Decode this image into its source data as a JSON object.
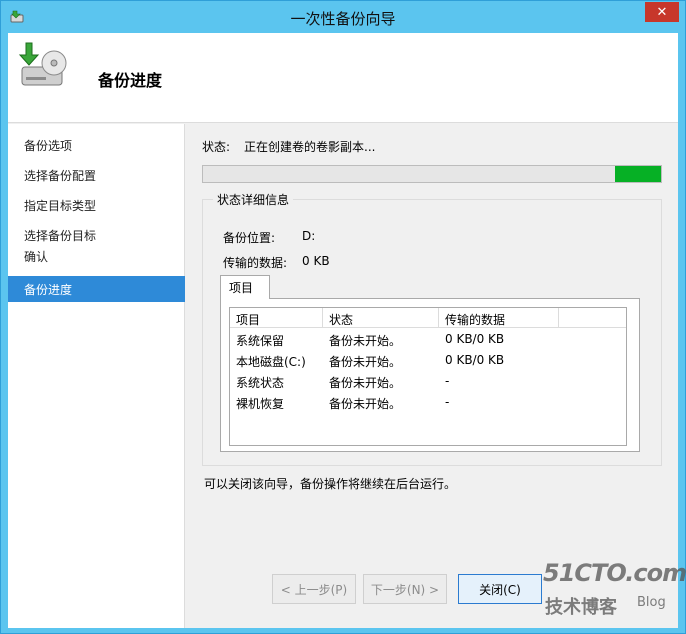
{
  "window": {
    "title": "一次性备份向导",
    "close_glyph": "✕"
  },
  "header": {
    "title": "备份进度"
  },
  "sidebar": {
    "items": [
      {
        "label": "备份选项"
      },
      {
        "label": "选择备份配置"
      },
      {
        "label": "指定目标类型"
      },
      {
        "label": "选择备份目标"
      },
      {
        "label": "确认"
      },
      {
        "label": "备份进度",
        "active": true
      }
    ]
  },
  "status": {
    "label": "状态:",
    "text": "正在创建卷的卷影副本...",
    "progress_fraction": 0.1
  },
  "details": {
    "legend": "状态详细信息",
    "location_label": "备份位置:",
    "location_value": "D:",
    "transferred_label": "传输的数据:",
    "transferred_value": "0 KB"
  },
  "tab": {
    "label": "项目"
  },
  "table": {
    "columns": [
      "项目",
      "状态",
      "传输的数据"
    ],
    "rows": [
      {
        "item": "系统保留",
        "status": "备份未开始。",
        "data": "0 KB/0 KB"
      },
      {
        "item": "本地磁盘(C:)",
        "status": "备份未开始。",
        "data": "0 KB/0 KB"
      },
      {
        "item": "系统状态",
        "status": "备份未开始。",
        "data": "-"
      },
      {
        "item": "裸机恢复",
        "status": "备份未开始。",
        "data": "-"
      }
    ]
  },
  "note": "可以关闭该向导，备份操作将继续在后台运行。",
  "buttons": {
    "back": "< 上一步(P)",
    "next": "下一步(N) >",
    "close": "关闭(C)"
  },
  "watermark": {
    "line1": "51CTO.com",
    "line2": "技术博客",
    "line3": "Blog"
  },
  "colors": {
    "title_bar": "#5bc5ef",
    "selection": "#2e8ad8",
    "progress": "#06b025",
    "close": "#c7372b"
  }
}
